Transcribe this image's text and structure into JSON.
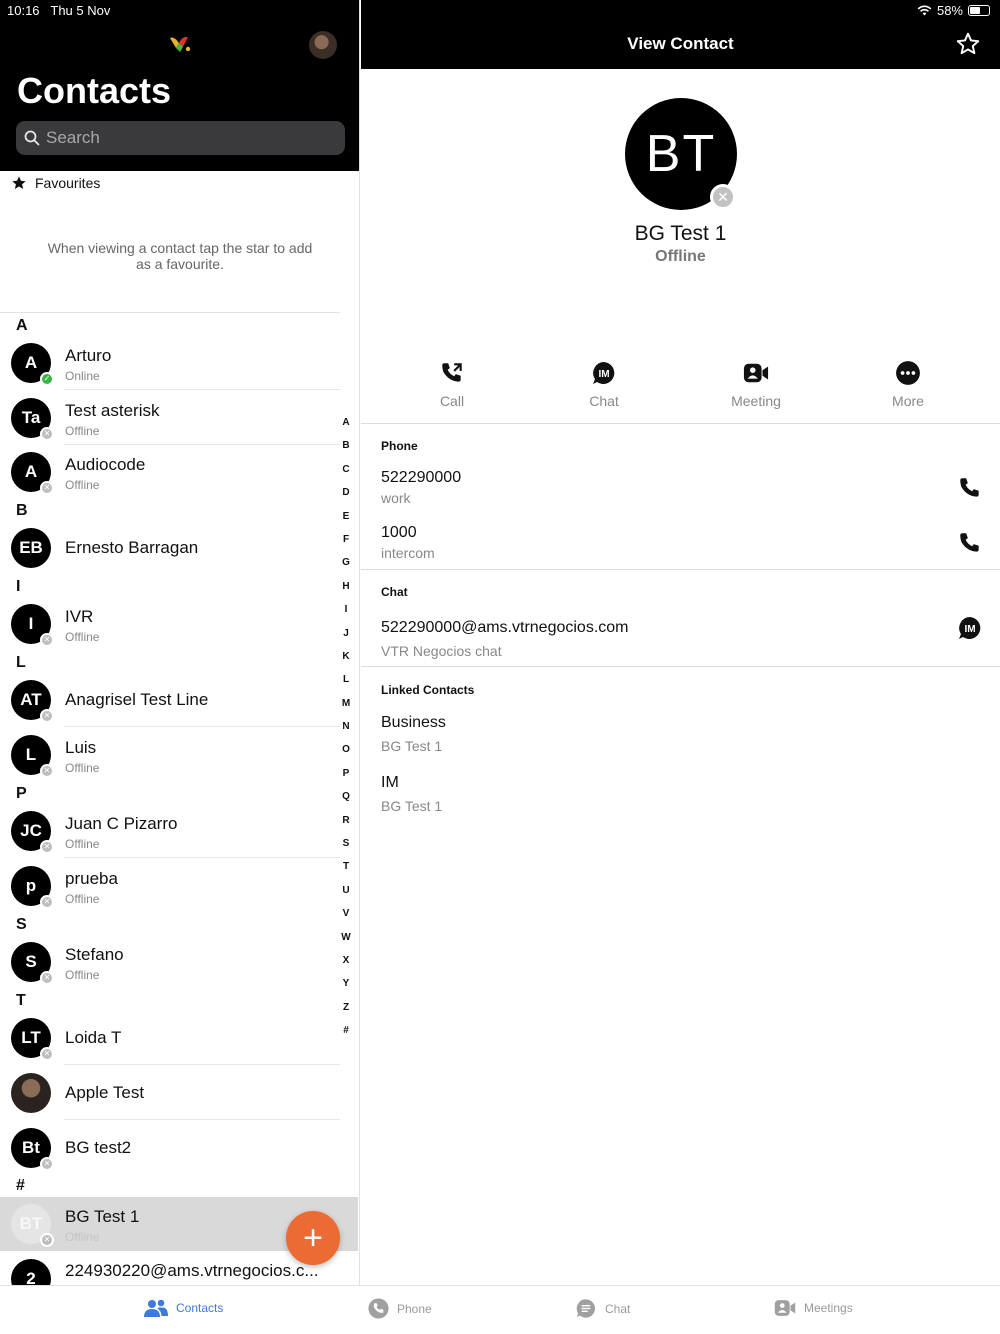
{
  "status_bar": {
    "time": "10:16",
    "date": "Thu 5 Nov",
    "battery": "58%",
    "battery_level": 0.58
  },
  "left": {
    "title": "Contacts",
    "search_placeholder": "Search",
    "favourites_label": "Favourites",
    "favourites_hint": "When viewing a contact tap the star to add as a favourite.",
    "sections": [
      "A",
      "B",
      "I",
      "L",
      "P",
      "S",
      "T",
      "#"
    ],
    "contacts": [
      {
        "initials": "A",
        "name": "Arturo",
        "status": "Online"
      },
      {
        "initials": "Ta",
        "name": "Test asterisk",
        "status": "Offline"
      },
      {
        "initials": "A",
        "name": "Audiocode",
        "status": "Offline"
      },
      {
        "initials": "EB",
        "name": "Ernesto Barragan",
        "status": ""
      },
      {
        "initials": "I",
        "name": "IVR",
        "status": "Offline"
      },
      {
        "initials": "AT",
        "name": "Anagrisel Test Line",
        "status": ""
      },
      {
        "initials": "L",
        "name": "Luis",
        "status": "Offline"
      },
      {
        "initials": "JC",
        "name": "Juan C Pizarro",
        "status": "Offline"
      },
      {
        "initials": "p",
        "name": "prueba",
        "status": "Offline"
      },
      {
        "initials": "S",
        "name": "Stefano",
        "status": "Offline"
      },
      {
        "initials": "LT",
        "name": "Loida T",
        "status": ""
      },
      {
        "initials": "",
        "name": "Apple Test",
        "status": ""
      },
      {
        "initials": "Bt",
        "name": "BG test2",
        "status": ""
      },
      {
        "initials": "BT",
        "name": "BG Test 1",
        "status": "Offline"
      },
      {
        "initials": "2",
        "name": "224930220@ams.vtrnegocios.c...",
        "status": ""
      }
    ],
    "index_letters": [
      "A",
      "B",
      "C",
      "D",
      "E",
      "F",
      "G",
      "H",
      "I",
      "J",
      "K",
      "L",
      "M",
      "N",
      "O",
      "P",
      "Q",
      "R",
      "S",
      "T",
      "U",
      "V",
      "W",
      "X",
      "Y",
      "Z",
      "#"
    ],
    "add_button": "+"
  },
  "right": {
    "title": "View Contact",
    "initials": "BT",
    "name": "BG Test 1",
    "status": "Offline",
    "actions": [
      "Call",
      "Chat",
      "Meeting",
      "More"
    ],
    "phone": {
      "title": "Phone",
      "entries": [
        {
          "number": "522290000",
          "type": "work"
        },
        {
          "number": "1000",
          "type": "intercom"
        }
      ]
    },
    "chat": {
      "title": "Chat",
      "address": "522290000@ams.vtrnegocios.com",
      "service": "VTR Negocios chat",
      "badge": "IM"
    },
    "linked": {
      "title": "Linked Contacts",
      "entries": [
        {
          "type": "Business",
          "name": "BG Test 1"
        },
        {
          "type": "IM",
          "name": "BG Test 1"
        }
      ]
    }
  },
  "tabbar": {
    "tabs": [
      "Contacts",
      "Phone",
      "Chat",
      "Meetings"
    ],
    "active": "Contacts"
  },
  "colors": {
    "accent": "#ec6a33",
    "tab_active": "#3c7ae0",
    "online": "#39b54a"
  }
}
